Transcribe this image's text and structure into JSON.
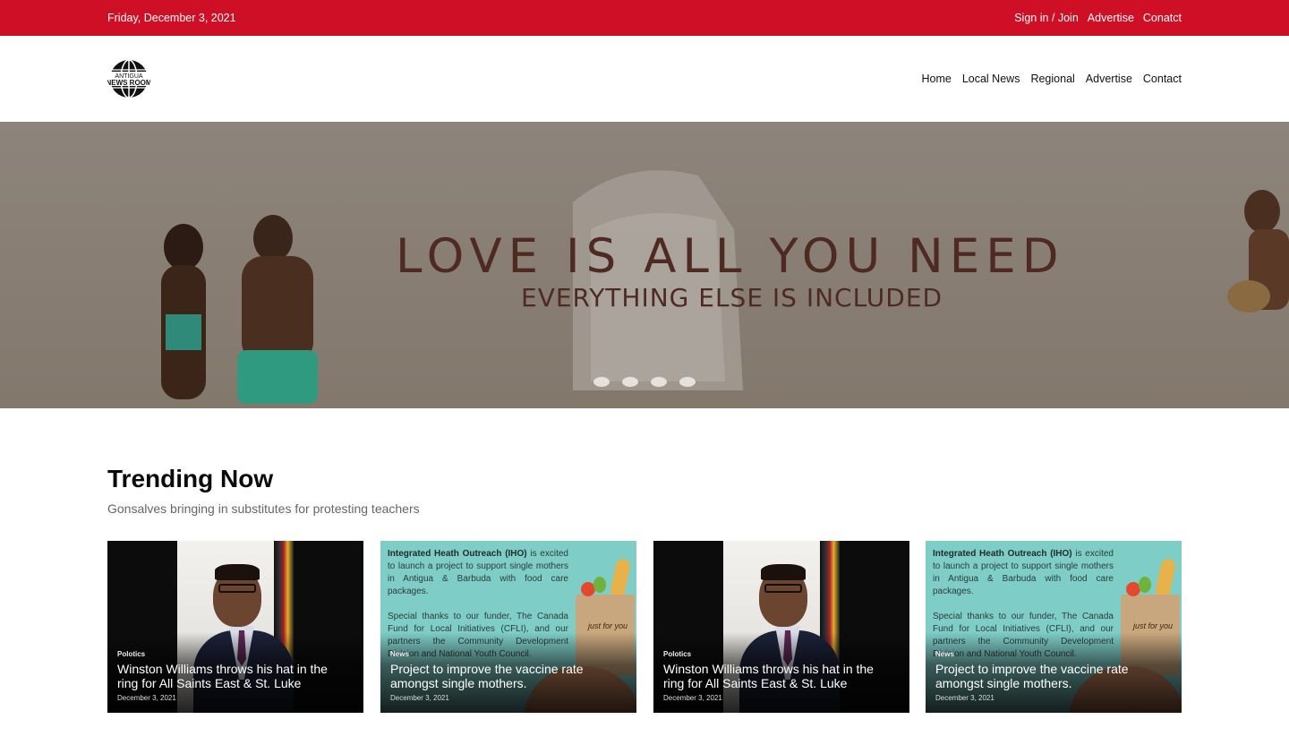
{
  "topbar": {
    "date": "Friday, December 3, 2021",
    "links": [
      "Sign in / Join",
      "Advertise",
      "Conatct"
    ]
  },
  "header": {
    "logo": {
      "line1": "ANTIGUA",
      "line2": "NEWS ROOM",
      "icon": "globe-icon"
    },
    "nav": [
      "Home",
      "Local News",
      "Regional",
      "Advertise",
      "Contact"
    ]
  },
  "hero": {
    "headline": "LOVE IS ALL YOU NEED",
    "subheadline": "EVERYTHING ELSE IS INCLUDED",
    "slide_count": 4
  },
  "trending": {
    "title": "Trending Now",
    "subtitle": "Gonsalves bringing in substitutes for protesting teachers",
    "cards": [
      {
        "category": "Polotics",
        "title": "Winston Williams throws his hat in the ring for All Saints East & St. Luke",
        "date": "December 3, 2021",
        "image": "portrait"
      },
      {
        "category": "News",
        "title": "Project to improve the vaccine rate amongst single mothers.",
        "date": "December 3, 2021",
        "image": "flyer"
      },
      {
        "category": "Polotics",
        "title": "Winston Williams throws his hat in the ring for All Saints East & St. Luke",
        "date": "December 3, 2021",
        "image": "portrait"
      },
      {
        "category": "News",
        "title": "Project to improve the vaccine rate amongst single mothers.",
        "date": "December 3, 2021",
        "image": "flyer"
      }
    ],
    "flyer": {
      "org": "Integrated Heath Outreach (IHO)",
      "p1_rest": " is excited to launch a project to support single mothers in Antigua & Barbuda with food care packages.",
      "p2": "Special thanks to our funder, The Canada Fund for Local Initiatives (CFLI), and our partners the Community Development Division and National Youth Council.",
      "bag_tag": "just for you"
    }
  },
  "colors": {
    "brand_red": "#cf0f26",
    "hero_text": "#4e2a22"
  }
}
